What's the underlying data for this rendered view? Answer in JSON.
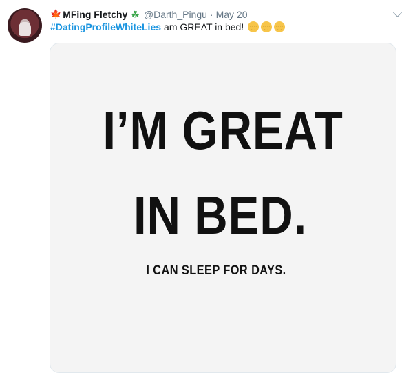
{
  "tweet": {
    "display_name": "MFing Fletchy",
    "handle": "@Darth_Pingu",
    "separator": "·",
    "date": "May 20",
    "hashtag": "#DatingProfileWhiteLies",
    "text": "am GREAT in bed!",
    "emojis": [
      "relieved-face-emoji",
      "relieved-face-emoji",
      "relieved-face-emoji"
    ],
    "name_prefix_icon": "maple-leaf-icon",
    "name_suffix_icon": "shamrock-icon"
  },
  "media": {
    "line1": "I’M GREAT",
    "line2": "IN BED.",
    "line3": "I CAN SLEEP FOR DAYS."
  },
  "colors": {
    "hashtag": "#1b95e0",
    "secondary_text": "#657786",
    "primary_text": "#14171a"
  }
}
